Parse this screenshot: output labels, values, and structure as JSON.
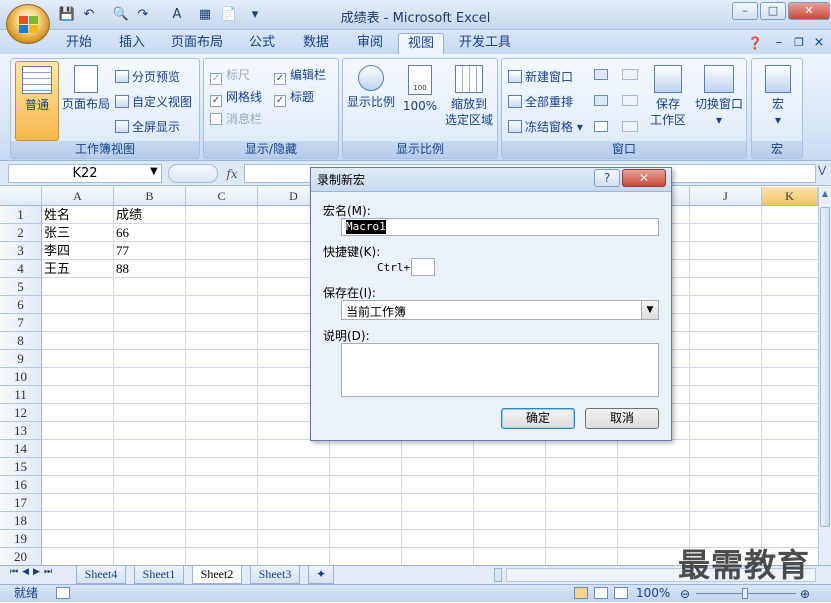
{
  "window": {
    "title": "成绩表 - Microsoft Excel"
  },
  "tabs": [
    "开始",
    "插入",
    "页面布局",
    "公式",
    "数据",
    "审阅",
    "视图",
    "开发工具"
  ],
  "active_tab": "视图",
  "ribbon": {
    "workbook_views": {
      "label": "工作簿视图",
      "normal": "普通",
      "page_layout": "页面布局",
      "page_break": "分页预览",
      "custom_views": "自定义视图",
      "full_screen": "全屏显示"
    },
    "show_hide": {
      "label": "显示/隐藏",
      "ruler": "标尺",
      "gridlines": "网格线",
      "message_bar": "消息栏",
      "formula_bar": "编辑栏",
      "headings": "标题"
    },
    "zoom": {
      "label": "显示比例",
      "zoom": "显示比例",
      "hundred": "100%",
      "zoom_to_selection_1": "缩放到",
      "zoom_to_selection_2": "选定区域",
      "hundred_icon": "100"
    },
    "window": {
      "label": "窗口",
      "new_window": "新建窗口",
      "arrange_all": "全部重排",
      "freeze_panes": "冻结窗格",
      "save_workspace_1": "保存",
      "save_workspace_2": "工作区",
      "switch_windows": "切换窗口"
    },
    "macros": {
      "label": "宏",
      "macros": "宏"
    }
  },
  "formula_bar": {
    "name_box": "K22",
    "fx": "fx",
    "value": ""
  },
  "grid": {
    "columns": [
      "A",
      "B",
      "C",
      "D",
      "J",
      "K"
    ],
    "rows": [
      "1",
      "2",
      "3",
      "4",
      "5",
      "6",
      "7",
      "8",
      "9",
      "10",
      "11",
      "12",
      "13",
      "14",
      "15",
      "16",
      "17",
      "18",
      "19",
      "20"
    ],
    "cells": [
      {
        "a": "姓名",
        "b": "成绩"
      },
      {
        "a": "张三",
        "b": "66"
      },
      {
        "a": "李四",
        "b": "77"
      },
      {
        "a": "王五",
        "b": "88"
      }
    ]
  },
  "sheets": [
    "Sheet4",
    "Sheet1",
    "Sheet2",
    "Sheet3"
  ],
  "active_sheet": "Sheet2",
  "status": {
    "ready": "就绪",
    "zoom": "100%"
  },
  "dialog": {
    "title": "录制新宏",
    "help": "?",
    "macro_name_label": "宏名(M):",
    "macro_name_value": "Macro1",
    "shortcut_label": "快捷键(K):",
    "shortcut_prefix": "Ctrl+",
    "shortcut_value": "",
    "store_in_label": "保存在(I):",
    "store_in_value": "当前工作簿",
    "description_label": "说明(D):",
    "description_value": "",
    "ok": "确定",
    "cancel": "取消"
  },
  "watermark": "最需教育",
  "colors": {
    "accent": "#15428b",
    "active_col_header": "#f8d58a"
  }
}
